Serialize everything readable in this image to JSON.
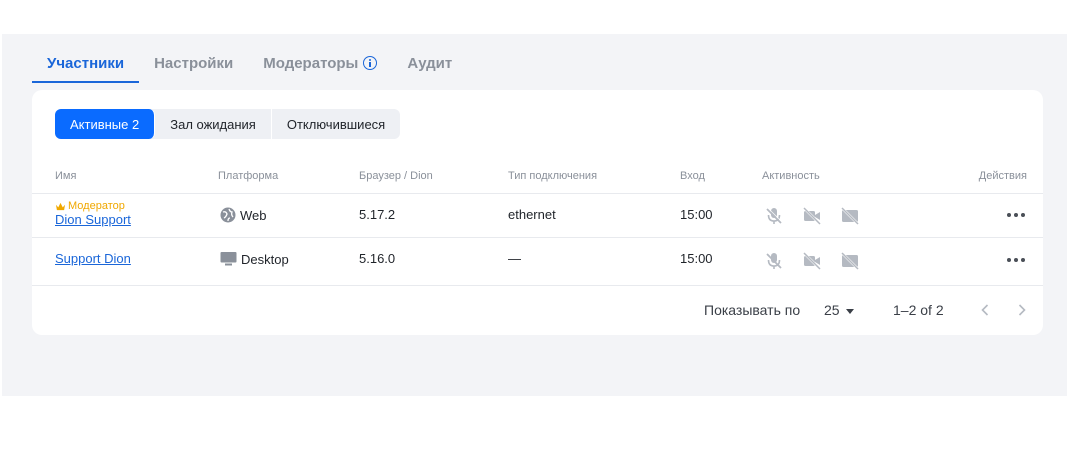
{
  "tabs": [
    {
      "label": "Участники",
      "active": true
    },
    {
      "label": "Настройки",
      "active": false
    },
    {
      "label": "Модераторы",
      "active": false,
      "icon": "info-icon"
    },
    {
      "label": "Аудит",
      "active": false
    }
  ],
  "segments": [
    {
      "label": "Активные 2",
      "active": true
    },
    {
      "label": "Зал ожидания",
      "active": false
    },
    {
      "label": "Отключившиеся",
      "active": false
    }
  ],
  "columns": {
    "name": "Имя",
    "platform": "Платформа",
    "browser": "Браузер / Dion",
    "connection": "Тип подключения",
    "login": "Вход",
    "activity": "Активность",
    "actions": "Действия"
  },
  "rows": [
    {
      "badge": "Модератор",
      "name": "Dion Support",
      "platform": "Web",
      "platform_icon": "globe-icon",
      "browser": "5.17.2",
      "connection": "ethernet",
      "login": "15:00"
    },
    {
      "badge": "",
      "name": "Support Dion",
      "platform": "Desktop",
      "platform_icon": "monitor-icon",
      "browser": "5.16.0",
      "connection": "—",
      "login": "15:00"
    }
  ],
  "pagination": {
    "per_page_label": "Показывать по",
    "per_page_value": "25",
    "range": "1–2 of 2"
  },
  "colors": {
    "accent": "#1a66d9",
    "active_segment": "#0a6bff",
    "moderator": "#f0a800"
  }
}
